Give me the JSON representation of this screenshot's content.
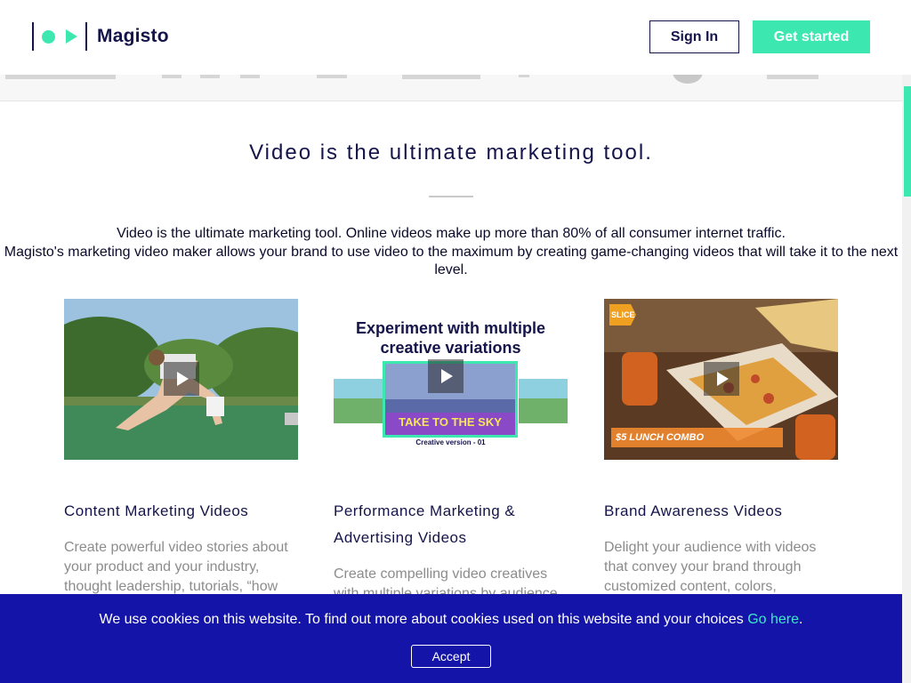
{
  "header": {
    "brand": "Magisto",
    "sign_in": "Sign In",
    "get_started": "Get started"
  },
  "hero": {
    "title": "Video is the ultimate marketing tool.",
    "intro_line1": "Video is the ultimate marketing tool. Online videos make up more than 80% of all consumer internet traffic.",
    "intro_line2": "Magisto's marketing video maker allows your brand to use video to the maximum by creating game-changing videos that will take it to the next level."
  },
  "cards": [
    {
      "title": "Content Marketing Videos",
      "description": "Create powerful video stories about your product and your industry, thought leadership, tutorials, “how"
    },
    {
      "title": "Performance Marketing & Advertising Videos",
      "description": "Create compelling video creatives with multiple variations by audience",
      "thumb_heading": "Experiment with multiple creative variations",
      "thumb_banner": "TAKE TO THE SKY",
      "thumb_caption": "Creative version - 01"
    },
    {
      "title": "Brand Awareness Videos",
      "description": "Delight your audience with videos that convey your brand through customized content, colors,",
      "thumb_logo": "SLICE",
      "thumb_banner": "$5 LUNCH COMBO"
    }
  ],
  "cookie": {
    "text": "We use cookies on this website. To find out more about cookies used on this website and your choices ",
    "link": "Go here",
    "after": ".",
    "accept": "Accept"
  },
  "colors": {
    "accent": "#3de8b0",
    "navy": "#14144a",
    "cookie_bg": "#1414a8"
  }
}
